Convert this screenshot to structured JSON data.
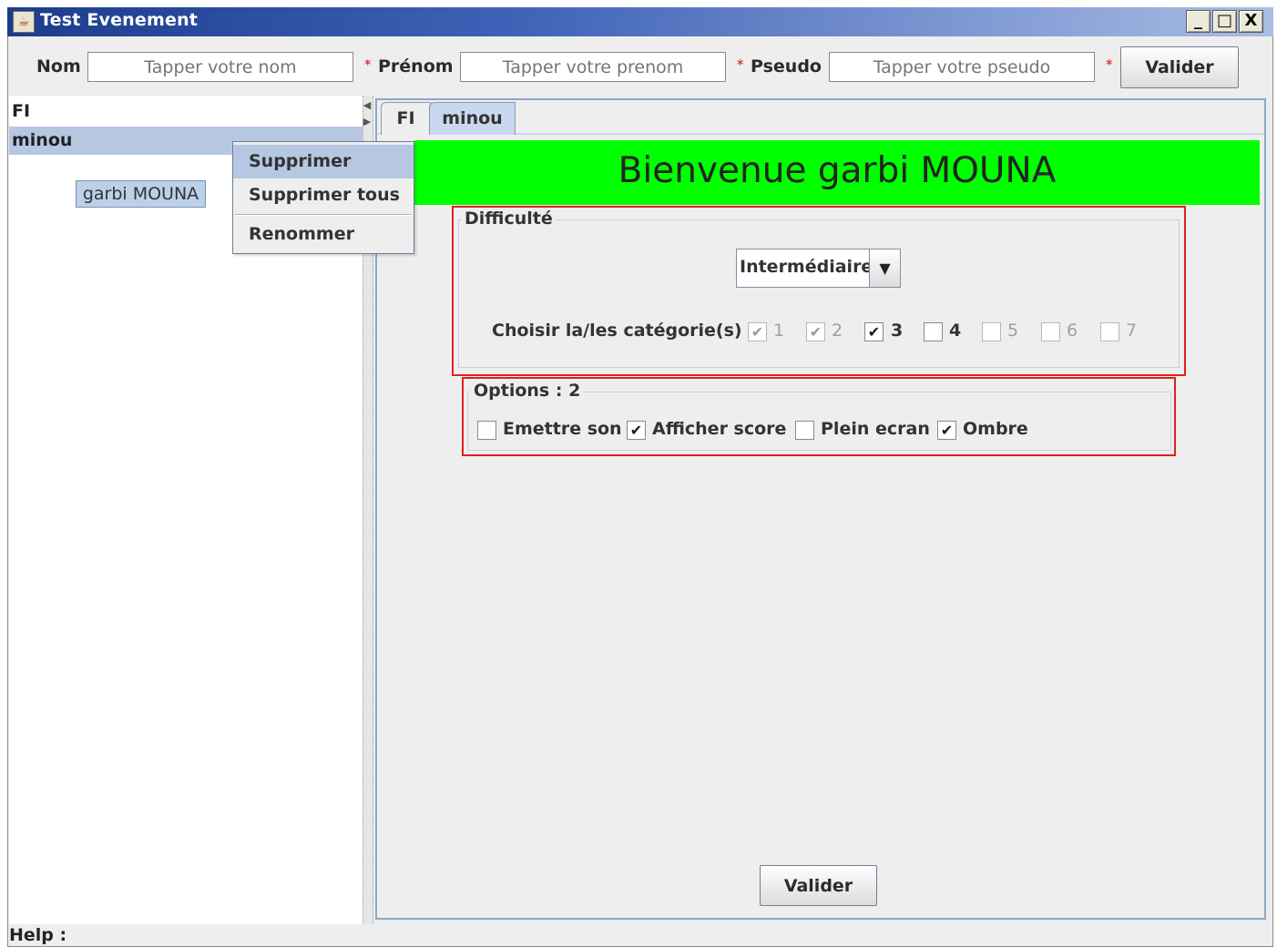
{
  "window": {
    "title": "Test Evenement",
    "controls": {
      "minimize": "_",
      "maximize": "□",
      "close": "X"
    }
  },
  "form": {
    "nom_label": "Nom",
    "nom_placeholder": "Tapper votre nom",
    "prenom_label": "Prénom",
    "prenom_placeholder": "Tapper votre prenom",
    "pseudo_label": "Pseudo",
    "pseudo_placeholder": "Tapper votre pseudo",
    "required_mark": "*",
    "valider_label": "Valider"
  },
  "tree": {
    "items": [
      {
        "label": "FI"
      },
      {
        "label": "minou"
      }
    ],
    "selected_user_label": "garbi MOUNA"
  },
  "context_menu": {
    "items": [
      {
        "label": "Supprimer"
      },
      {
        "label": "Supprimer tous"
      },
      {
        "label": "Renommer"
      }
    ]
  },
  "tabs": [
    {
      "label": "FI"
    },
    {
      "label": "minou"
    }
  ],
  "main": {
    "welcome": "Bienvenue garbi MOUNA",
    "difficulty": {
      "title": "Difficulté",
      "selected": "Intermédiaire",
      "categories_label": "Choisir la/les catégorie(s) :",
      "categories": [
        {
          "label": "1",
          "checked": true,
          "enabled": false
        },
        {
          "label": "2",
          "checked": true,
          "enabled": false
        },
        {
          "label": "3",
          "checked": true,
          "enabled": true
        },
        {
          "label": "4",
          "checked": false,
          "enabled": true
        },
        {
          "label": "5",
          "checked": false,
          "enabled": false
        },
        {
          "label": "6",
          "checked": false,
          "enabled": false
        },
        {
          "label": "7",
          "checked": false,
          "enabled": false
        }
      ]
    },
    "options": {
      "title": "Options : 2",
      "items": [
        {
          "label": "Emettre son",
          "checked": false
        },
        {
          "label": "Afficher score",
          "checked": true
        },
        {
          "label": "Plein ecran",
          "checked": false
        },
        {
          "label": "Ombre",
          "checked": true
        }
      ]
    },
    "valider_label": "Valider"
  },
  "status": {
    "help_label": "Help :"
  },
  "colors": {
    "banner": "#00ff00",
    "group_border": "#e02020",
    "selection": "#b6c7e2",
    "titlebar": "#1c3c8c"
  }
}
